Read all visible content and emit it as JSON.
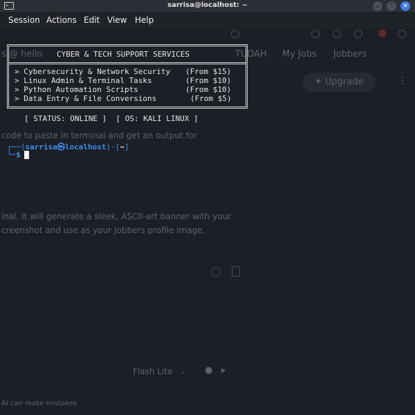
{
  "window": {
    "title": "sarrisa@localhost: ~",
    "terminal_icon_glyph": ">_",
    "minimize_glyph": "⌄",
    "maximize_glyph": "⌃",
    "close_glyph": "✕"
  },
  "menu": [
    "Session",
    "Actions",
    "Edit",
    "View",
    "Help"
  ],
  "banner": {
    "title": "CYBER & TECH SUPPORT SERVICES",
    "services": [
      {
        "name": "> Cybersecurity & Network Security",
        "price": "(From $15)"
      },
      {
        "name": "> Linux Admin & Terminal Tasks",
        "price": "(From $10)"
      },
      {
        "name": "> Python Automation Scripts",
        "price": "(From $10)"
      },
      {
        "name": "> Data Entry & File Conversions",
        "price": "(From $5)"
      }
    ],
    "status": "[ STATUS: ONLINE ]  [ OS: KALI LINUX ]"
  },
  "prompt": {
    "corner_top": "┌──(",
    "user_host": "sarrisa㉿localhost",
    "dir_open": ")-[",
    "dir": "~",
    "dir_close": "]",
    "corner_bottom": "└─",
    "symbol": "$"
  },
  "background": {
    "tab_text_left": "s @ hello",
    "tab_text_mid": "TUDAH",
    "tab_text_right": "My Jobs",
    "tab_text_right2": "Jobbers",
    "upgrade_label": "Upgrade",
    "line1": "code to paste in terminal and get an output for",
    "line2": "inal. It will generate a sleek, ASCII-art banner with your",
    "line3": "creenshot and use as your Jobbers profile image.",
    "model_label": "Flash Lite",
    "footer": "AI can make mistakes"
  }
}
